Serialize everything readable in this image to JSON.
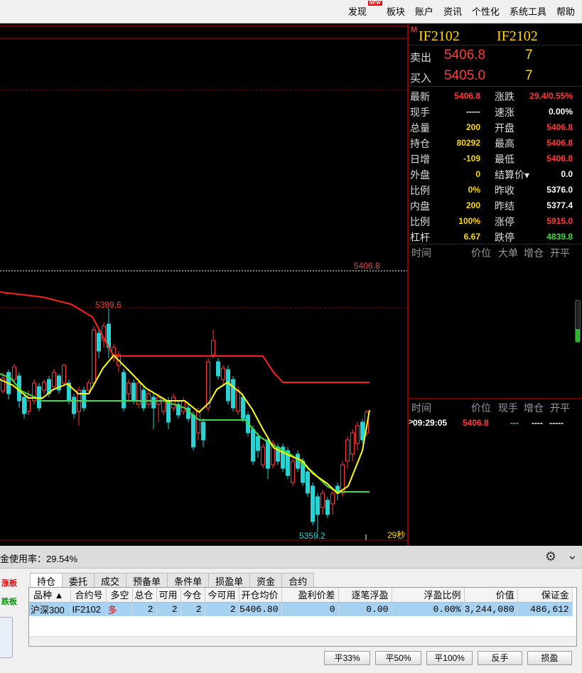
{
  "menu": {
    "items": [
      "发现",
      "板块",
      "账户",
      "资讯",
      "个性化",
      "系统工具",
      "帮助"
    ],
    "new_badge": "NEW"
  },
  "chart": {
    "price_labels": {
      "last": "5406.8",
      "high": "5399.6",
      "low": "5359.2"
    },
    "countdown": "29秒",
    "colors": {
      "up_candle": "#ff3c3c",
      "down_candle": "#29d3d3",
      "avg_line": "#ffff00",
      "ma_line": "#3fdd3f",
      "limit_line": "#ff2020"
    }
  },
  "quote": {
    "marker": "M",
    "symbol": "IF2102",
    "symbol2": "IF2102",
    "orderbook": [
      {
        "label": "卖出",
        "price": "5406.8",
        "volume": "7"
      },
      {
        "label": "买入",
        "price": "5405.0",
        "volume": "7"
      }
    ],
    "stats": [
      {
        "l1": "最新",
        "v1": "5406.8",
        "c1": "red",
        "l2": "涨跌",
        "v2": "29.4/0.55%",
        "c2": "red"
      },
      {
        "l1": "现手",
        "v1": "-----",
        "c1": "wht",
        "l2": "速涨",
        "v2": "0.00%",
        "c2": "wht"
      },
      {
        "l1": "总量",
        "v1": "200",
        "c1": "yel",
        "l2": "开盘",
        "v2": "5406.8",
        "c2": "red"
      },
      {
        "l1": "持仓",
        "v1": "80292",
        "c1": "yel",
        "l2": "最高",
        "v2": "5406.8",
        "c2": "red"
      },
      {
        "l1": "日增",
        "v1": "-109",
        "c1": "yel",
        "l2": "最低",
        "v2": "5406.8",
        "c2": "red"
      },
      {
        "l1": "外盘",
        "v1": "0",
        "c1": "yel",
        "l2": "结算价▾",
        "v2": "0.0",
        "c2": "wht"
      },
      {
        "l1": "比例",
        "v1": "0%",
        "c1": "yel",
        "l2": "昨收",
        "v2": "5376.0",
        "c2": "wht"
      },
      {
        "l1": "内盘",
        "v1": "200",
        "c1": "yel",
        "l2": "昨结",
        "v2": "5377.4",
        "c2": "wht"
      },
      {
        "l1": "比例",
        "v1": "100%",
        "c1": "yel",
        "l2": "涨停",
        "v2": "5915.0",
        "c2": "red"
      },
      {
        "l1": "杠杆",
        "v1": "6.67",
        "c1": "yel",
        "l2": "跌停",
        "v2": "4839.8",
        "c2": "grn"
      }
    ],
    "big_header": [
      "时间",
      "价位",
      "大单",
      "增仓",
      "开平"
    ],
    "tick_header": [
      "时间",
      "价位",
      "现手",
      "增仓",
      "开平"
    ],
    "tick": {
      "time": "09:29:05",
      "price": "5406.8",
      "vol": "---",
      "oi": "----",
      "type": "-----"
    }
  },
  "bottom": {
    "usage_text": "金使用率：29.54%",
    "side_up": "涨板",
    "side_down": "跌板",
    "tabs": [
      "持仓",
      "委托",
      "成交",
      "预备单",
      "条件单",
      "损盈单",
      "资金",
      "合约"
    ],
    "columns": [
      "品种 ▲",
      "合约号",
      "多空",
      "总仓",
      "可用",
      "今仓",
      "今可用",
      "开仓均价",
      "盈利价差",
      "逐笔浮盈",
      "浮盈比例",
      "价值",
      "保证金"
    ],
    "row": [
      "沪深300",
      "IF2102",
      "多",
      "2",
      "2",
      "2",
      "2",
      "5406.80",
      "0",
      "0.00",
      "0.00%",
      "3,244,080",
      "486,612"
    ],
    "buttons": [
      "平33%",
      "平50%",
      "平100%",
      "反手",
      "损盈"
    ]
  }
}
